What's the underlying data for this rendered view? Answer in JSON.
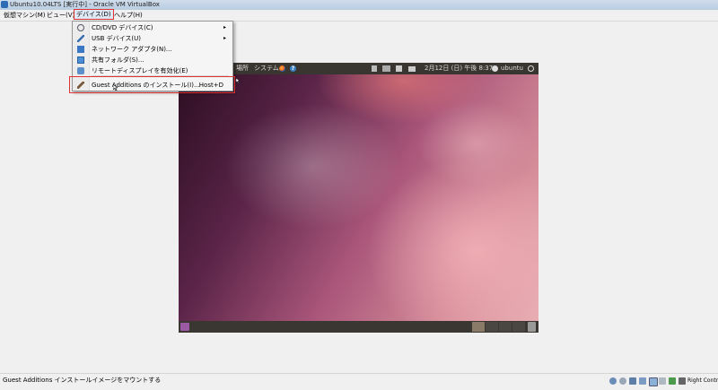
{
  "window": {
    "title": "Ubuntu10.04LTS [実行中] - Oracle VM VirtualBox"
  },
  "menubar": {
    "items": [
      {
        "label": "仮想マシン(M)"
      },
      {
        "label": "ビュー(V)"
      },
      {
        "label": "デバイス(D)"
      },
      {
        "label": "ヘルプ(H)"
      }
    ]
  },
  "devices_menu": {
    "items": [
      {
        "label": "CD/DVD デバイス(C)",
        "icon": "cd-dvd-icon",
        "submenu": "▸"
      },
      {
        "label": "USB デバイス(U)",
        "icon": "usb-icon",
        "submenu": "▸"
      },
      {
        "label": "ネットワーク アダプタ(N)...",
        "icon": "network-adapter-icon"
      },
      {
        "label": "共有フォルダ(S)...",
        "icon": "shared-folder-icon"
      },
      {
        "label": "リモートディスプレイを有効化(E)",
        "icon": "remote-display-icon"
      }
    ],
    "guest_additions": {
      "label": "Guest Additions のインストール(I)...",
      "shortcut": "Host+D",
      "icon": "guest-additions-icon"
    }
  },
  "guest": {
    "top_panel": {
      "places": "場所",
      "system": "システム",
      "help": "?",
      "datetime": "2月12日 (日) 午後 8:37",
      "user": "ubuntu"
    }
  },
  "statusbar": {
    "text": "Guest Additions インストールイメージをマウントする",
    "host_key": "Right Control"
  },
  "colors": {
    "highlight_border": "#dd3333",
    "guest_panel": "#393530",
    "desktop_accent": "#a9567a"
  }
}
